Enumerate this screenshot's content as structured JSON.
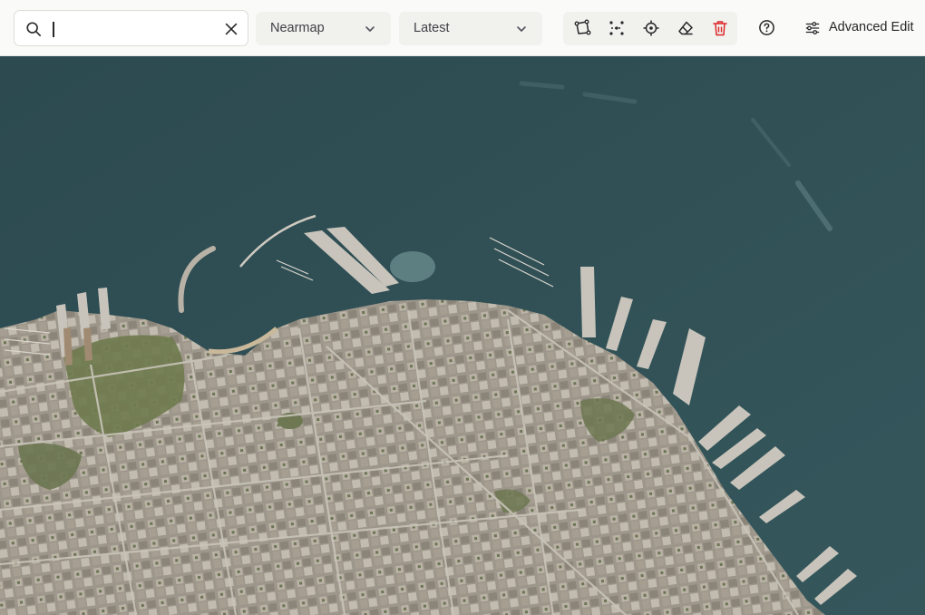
{
  "search": {
    "value": "",
    "placeholder": ""
  },
  "source_dropdown": {
    "selected": "Nearmap"
  },
  "date_dropdown": {
    "selected": "Latest"
  },
  "tools": [
    "polygon-tool-icon",
    "line-tool-icon",
    "locate-icon",
    "eraser-icon",
    "trash-icon"
  ],
  "advanced_edit": {
    "label": "Advanced Edit"
  },
  "colors": {
    "water": "#2f4e54",
    "land": "#a9a294",
    "park": "#6f7a4e",
    "delete": "#dc2626"
  }
}
